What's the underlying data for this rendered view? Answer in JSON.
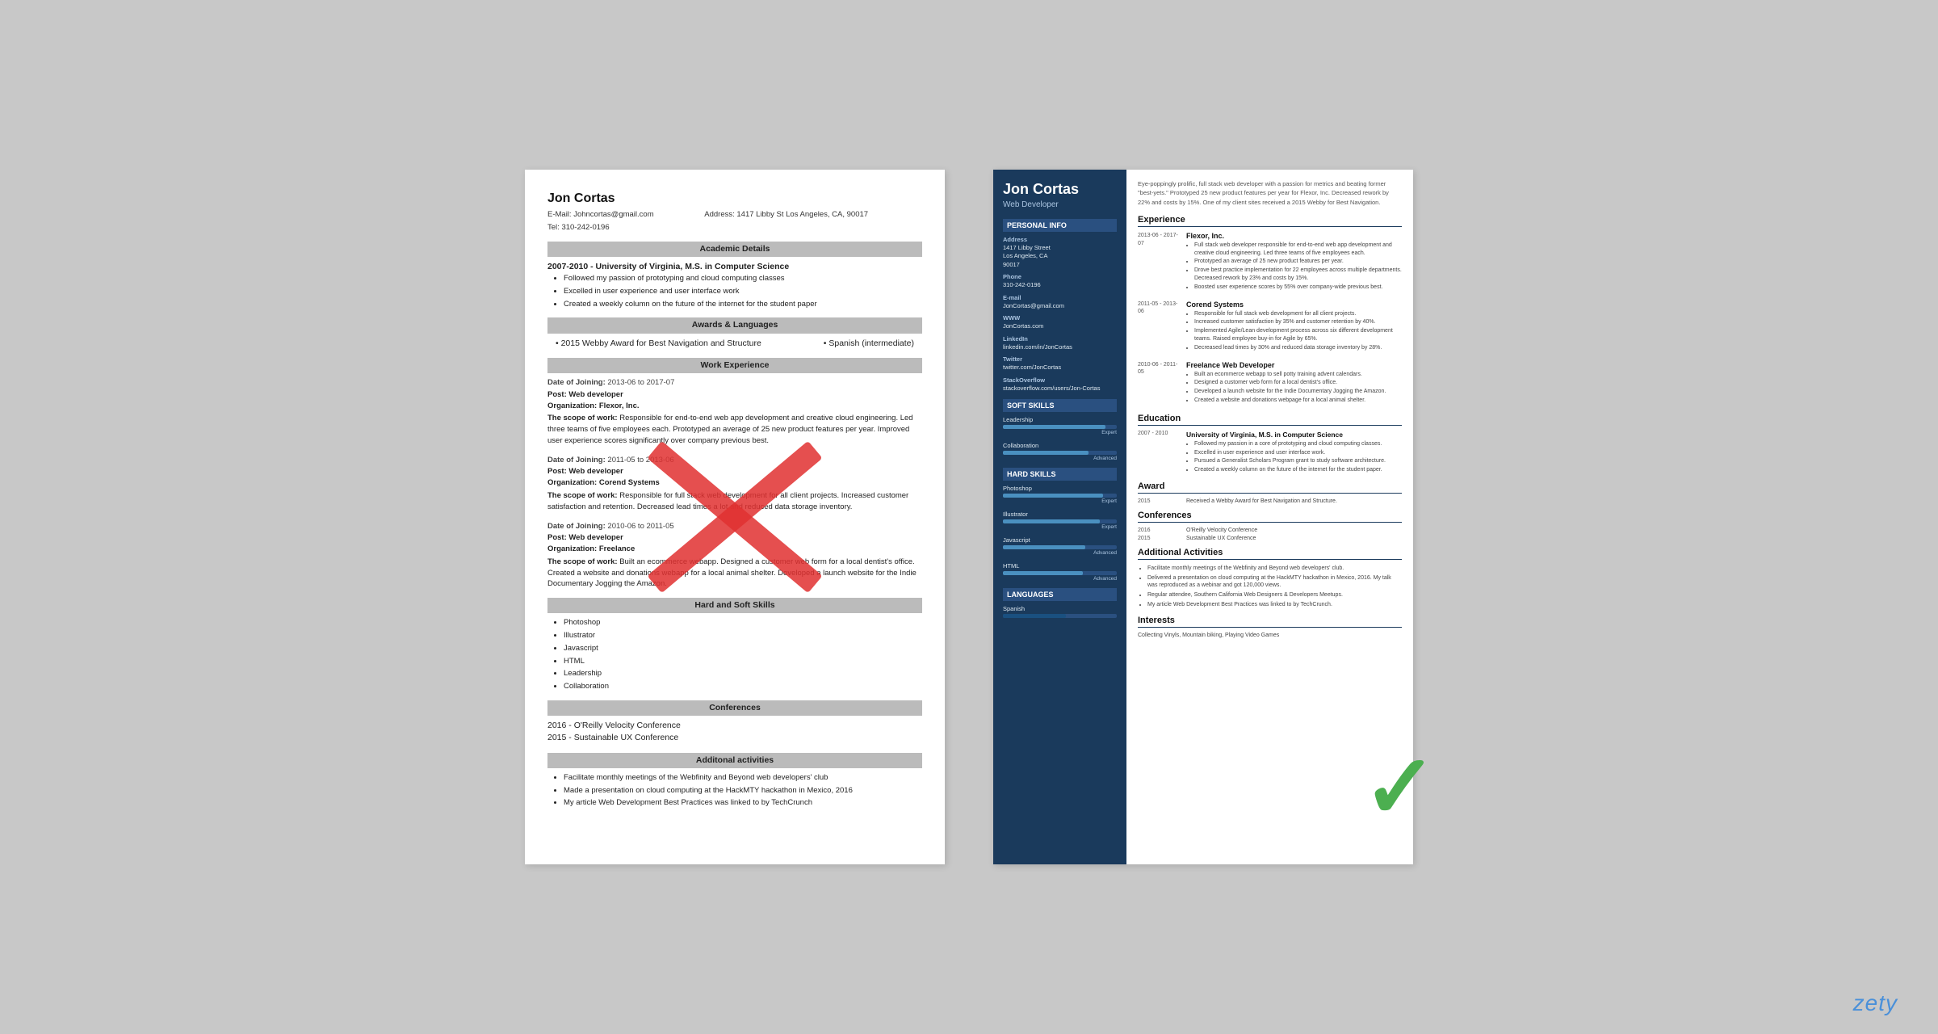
{
  "left_resume": {
    "name": "Jon Cortas",
    "email_label": "E-Mail:",
    "email": "Johncortas@gmail.com",
    "address_label": "Address:",
    "address": "1417 Libby St Los Angeles, CA, 90017",
    "tel_label": "Tel:",
    "tel": "310-242-0196",
    "academic_section": "Academic Details",
    "academic_period": "2007-2010 - University of Virginia, M.S. in Computer Science",
    "academic_bullets": [
      "Followed my passion of prototyping and cloud computing classes",
      "Excelled in user experience and user interface work",
      "Created a weekly column on the future of the internet for the student paper"
    ],
    "awards_section": "Awards & Languages",
    "award": "2015 Webby Award for Best Navigation and Structure",
    "language": "Spanish (intermediate)",
    "work_section": "Work Experience",
    "jobs": [
      {
        "date_label": "Date of Joining:",
        "date": "2013-06 to 2017-07",
        "post_label": "Post:",
        "post": "Web developer",
        "org_label": "Organization:",
        "org": "Flexor, Inc.",
        "scope_label": "The scope of work:",
        "scope": "Responsible for end-to-end web app development and creative cloud engineering. Led three teams of five employees each. Prototyped an average of 25 new product features per year. Improved user experience scores significantly over company previous best."
      },
      {
        "date_label": "Date of Joining:",
        "date": "2011-05 to 2013-06",
        "post_label": "Post:",
        "post": "Web developer",
        "org_label": "Organization:",
        "org": "Corend Systems",
        "scope_label": "The scope of work:",
        "scope": "Responsible for full stack web development for all client projects. Increased customer satisfaction and retention. Decreased lead times a lot and reduced data storage inventory."
      },
      {
        "date_label": "Date of Joining:",
        "date": "2010-06 to 2011-05",
        "post_label": "Post:",
        "post": "Web developer",
        "org_label": "Organization:",
        "org": "Freelance",
        "scope_label": "The scope of work:",
        "scope": "Built an ecommerce webapp. Designed a customer web form for a local dentist's office. Created a website and donations webapp for a local animal shelter. Developed a launch website for the Indie Documentary Jogging the Amazon."
      }
    ],
    "skills_section": "Hard and Soft Skills",
    "skills": [
      "Photoshop",
      "Illustrator",
      "Javascript",
      "HTML",
      "Leadership",
      "Collaboration"
    ],
    "conf_section": "Conferences",
    "conferences": [
      "2016 - O'Reilly Velocity Conference",
      "2015 - Sustainable UX Conference"
    ],
    "activities_section": "Additonal activities",
    "activities": [
      "Facilitate monthly meetings of the Webfinity and Beyond web developers' club",
      "Made a presentation on cloud computing at the HackMTY hackathon in Mexico, 2016",
      "My article Web Development Best Practices was linked to by TechCrunch"
    ]
  },
  "right_resume": {
    "name": "Jon Cortas",
    "title": "Web Developer",
    "summary": "Eye-poppingly prolific, full stack web developer with a passion for metrics and beating former \"best-yets.\" Prototyped 25 new product features per year for Flexor, Inc. Decreased rework by 22% and costs by 15%. One of my client sites received a 2015 Webby for Best Navigation.",
    "personal_info_title": "Personal Info",
    "address_label": "Address",
    "address_lines": [
      "1417 Libby Street",
      "Los Angeles, CA",
      "90017"
    ],
    "phone_label": "Phone",
    "phone": "310-242-0196",
    "email_label": "E-mail",
    "email": "JonCortas@gmail.com",
    "www_label": "WWW",
    "www": "JonCortas.com",
    "linkedin_label": "LinkedIn",
    "linkedin": "linkedin.com/in/JonCortas",
    "twitter_label": "Twitter",
    "twitter": "twitter.com/JonCortas",
    "stackoverflow_label": "StackOverflow",
    "stackoverflow": "stackoverflow.com/users/Jon-Cortas",
    "soft_skills_title": "Soft Skills",
    "soft_skills": [
      {
        "name": "Leadership",
        "level": "Expert",
        "percent": 90
      },
      {
        "name": "Collaboration",
        "level": "Advanced",
        "percent": 75
      }
    ],
    "hard_skills_title": "Hard Skills",
    "hard_skills": [
      {
        "name": "Photoshop",
        "level": "Expert",
        "percent": 88
      },
      {
        "name": "Illustrator",
        "level": "Expert",
        "percent": 85
      },
      {
        "name": "Javascript",
        "level": "Advanced",
        "percent": 72
      },
      {
        "name": "HTML",
        "level": "Advanced",
        "percent": 70
      }
    ],
    "languages_title": "Languages",
    "languages": [
      {
        "name": "Spanish",
        "percent": 55
      }
    ],
    "experience_title": "Experience",
    "jobs": [
      {
        "dates": "2013-06 -\n2017-07",
        "company": "Flexor, Inc.",
        "bullets": [
          "Full stack web developer responsible for end-to-end web app development and creative cloud engineering. Led three teams of five employees each.",
          "Prototyped an average of 25 new product features per year.",
          "Drove best practice implementation for 22 employees across multiple departments. Decreased rework by 23% and costs by 15%.",
          "Boosted user experience scores by 55% over company-wide previous best."
        ]
      },
      {
        "dates": "2011-05 -\n2013-06",
        "company": "Corend Systems",
        "bullets": [
          "Responsible for full stack web development for all client projects.",
          "Increased customer satisfaction by 35% and customer retention by 40%.",
          "Implemented Agile/Lean development process across six different development teams. Raised employee buy-in for Agile by 65%.",
          "Decreased lead times by 30% and reduced data storage inventory by 28%."
        ]
      },
      {
        "dates": "2010-06 -\n2011-05",
        "company": "Freelance Web Developer",
        "bullets": [
          "Built an ecommerce webapp to sell potty training advent calendars.",
          "Designed a customer web form for a local dentist's office.",
          "Developed a launch website for the Indie Documentary Jogging the Amazon.",
          "Created a website and donations webpage for a local animal shelter."
        ]
      }
    ],
    "education_title": "Education",
    "education": [
      {
        "dates": "2007 -\n2010",
        "school": "University of Virginia, M.S. in Computer Science",
        "bullets": [
          "Followed my passion in a core of prototyping and cloud computing classes.",
          "Excelled in user experience and user interface work.",
          "Pursued a Generalist Scholars Program grant to study software architecture.",
          "Created a weekly column on the future of the internet for the student paper."
        ]
      }
    ],
    "award_title": "Award",
    "award_year": "2015",
    "award_text": "Received a Webby Award for Best Navigation and Structure.",
    "conferences_title": "Conferences",
    "conferences": [
      {
        "year": "2016",
        "name": "O'Reilly Velocity Conference"
      },
      {
        "year": "2015",
        "name": "Sustainable UX Conference"
      }
    ],
    "additional_title": "Additional Activities",
    "additional_bullets": [
      "Facilitate monthly meetings of the Webfinity and Beyond web developers' club.",
      "Delivered a presentation on cloud computing at the HackMTY hackathon in Mexico, 2016. My talk was reproduced as a webinar and got 120,000 views.",
      "Regular attendee, Southern California Web Designers & Developers Meetups.",
      "My article Web Development Best Practices was linked to by TechCrunch."
    ],
    "interests_title": "Interests",
    "interests_text": "Collecting Vinyls, Mountain biking, Playing Video Games"
  },
  "zety_logo": "zety"
}
